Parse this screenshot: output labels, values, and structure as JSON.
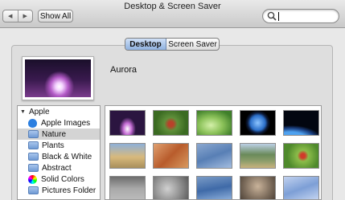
{
  "window": {
    "title": "Desktop & Screen Saver"
  },
  "toolbar": {
    "back_label": "◀",
    "forward_label": "▶",
    "show_all_label": "Show All",
    "search": {
      "value": "",
      "placeholder": ""
    }
  },
  "tabs": [
    {
      "label": "Desktop",
      "selected": true
    },
    {
      "label": "Screen Saver",
      "selected": false
    }
  ],
  "preview": {
    "name": "Aurora"
  },
  "sidebar": {
    "group": "Apple",
    "items": [
      {
        "label": "Apple Images",
        "icon": "apple-icon"
      },
      {
        "label": "Nature",
        "icon": "folder-icon",
        "selected": true
      },
      {
        "label": "Plants",
        "icon": "folder-icon"
      },
      {
        "label": "Black & White",
        "icon": "folder-icon"
      },
      {
        "label": "Abstract",
        "icon": "folder-icon"
      },
      {
        "label": "Solid Colors",
        "icon": "color-wheel-icon"
      },
      {
        "label": "Pictures Folder",
        "icon": "folder-icon"
      }
    ]
  },
  "colors": {
    "accent": "#8fb1df",
    "selection": "#d4d4d4"
  }
}
